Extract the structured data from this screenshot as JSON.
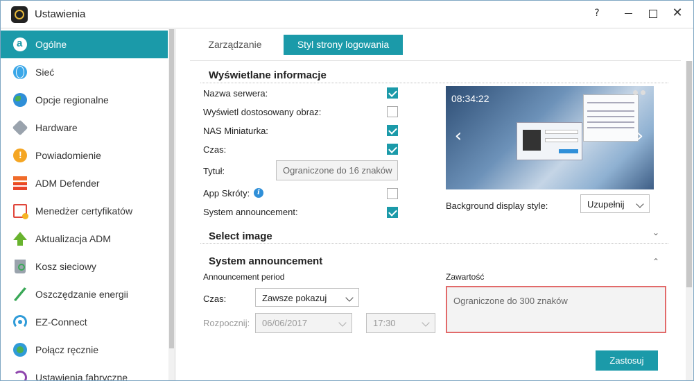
{
  "window": {
    "title": "Ustawienia",
    "help": "?",
    "close": "✕"
  },
  "sidebar": {
    "items": [
      {
        "label": "Ogólne"
      },
      {
        "label": "Sieć"
      },
      {
        "label": "Opcje regionalne"
      },
      {
        "label": "Hardware"
      },
      {
        "label": "Powiadomienie"
      },
      {
        "label": "ADM Defender"
      },
      {
        "label": "Menedżer certyfikatów"
      },
      {
        "label": "Aktualizacja ADM"
      },
      {
        "label": "Kosz sieciowy"
      },
      {
        "label": "Oszczędzanie energii"
      },
      {
        "label": "EZ-Connect"
      },
      {
        "label": "Połącz ręcznie"
      },
      {
        "label": "Ustawienia fabryczne"
      }
    ],
    "active": "Ogólne"
  },
  "tabs": {
    "manage": "Zarządzanie",
    "login_style": "Styl strony logowania",
    "active": "Styl strony logowania"
  },
  "display_info": {
    "title": "Wyświetlane informacje",
    "server_name": {
      "label": "Nazwa serwera:",
      "checked": true
    },
    "custom_image": {
      "label": "Wyświetl dostosowany obraz:",
      "checked": false
    },
    "nas_thumbnail": {
      "label": "NAS Miniaturka:",
      "checked": true
    },
    "time": {
      "label": "Czas:",
      "checked": true
    },
    "title_field": {
      "label": "Tytuł:",
      "placeholder": "Ograniczone do 16 znaków"
    },
    "app_shortcuts": {
      "label": "App Skróty:",
      "checked": false,
      "info_icon": "i"
    },
    "system_announcement": {
      "label": "System announcement:",
      "checked": true
    }
  },
  "preview": {
    "time": "08:34:22",
    "left_arrow": "‹",
    "right_arrow": "›"
  },
  "background": {
    "label": "Background display style:",
    "value": "Uzupełnij"
  },
  "select_image": {
    "title": "Select image",
    "chevron": "⌄"
  },
  "announcement": {
    "title": "System announcement",
    "chevron": "⌃",
    "period_label": "Announcement period",
    "time_label": "Czas:",
    "time_value": "Zawsze pokazuj",
    "start_label": "Rozpocznij:",
    "start_date": "06/06/2017",
    "start_time": "17:30",
    "content_label": "Zawartość",
    "content_placeholder": "Ograniczone do 300 znaków"
  },
  "apply_label": "Zastosuj",
  "colors": {
    "accent": "#1b9aa9",
    "error_border": "#e26a6a"
  }
}
